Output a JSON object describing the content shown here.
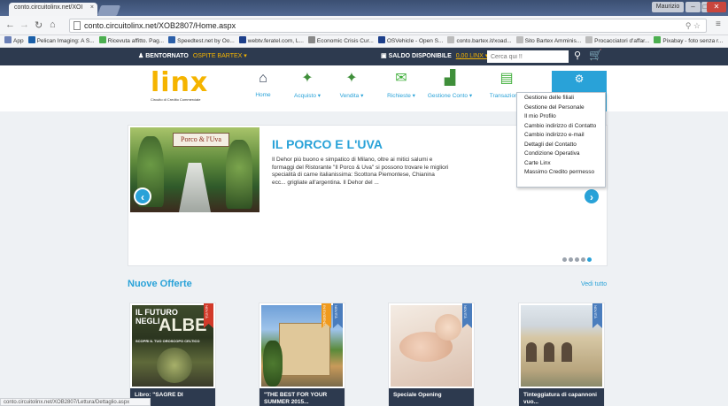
{
  "browser": {
    "tab_title": "conto.circuitolinx.net/XOI",
    "tab_close": "×",
    "user_chip": "Maurizio",
    "win_min": "–",
    "win_max": "□",
    "win_close": "✕",
    "url": "conto.circuitolinx.net/XOB2807/Home.aspx",
    "bookmarks": [
      {
        "label": "App",
        "color": "#6a7fb6"
      },
      {
        "label": "Pelican Imaging: A S...",
        "color": "#1a5fa8"
      },
      {
        "label": "Ricevuta affitto. Pag...",
        "color": "#4caf50"
      },
      {
        "label": "Speedtest.net by Oo...",
        "color": "#2b5fa8"
      },
      {
        "label": "webtv.feratel.com, L...",
        "color": "#1d3f8a"
      },
      {
        "label": "Economic Crisis Cur...",
        "color": "#888888"
      },
      {
        "label": "OSVehicle - Open S...",
        "color": "#1d3f8a"
      },
      {
        "label": "conto.bartex.it/xoad...",
        "color": "#bbbbbb"
      },
      {
        "label": "Sito Bartex Amminis...",
        "color": "#bbbbbb"
      },
      {
        "label": "Procacciatori d'affar...",
        "color": "#bbbbbb"
      },
      {
        "label": "Pixabay - foto senza r...",
        "color": "#4caf50"
      }
    ],
    "status_text": "conto.circuitolinx.net/XOB2807/Lettura/Dettaglio.aspx"
  },
  "topbar": {
    "greeting": "BENTORNATO",
    "guest": "OSPITE BARTEX ▾",
    "saldo_label": "SALDO DISPONIBILE",
    "saldo_amount": "0,00 LINX ▾",
    "search_placeholder": "Cerca qui !!"
  },
  "logo": {
    "text": "linx",
    "sub": "Circuito di Credito Commerciale"
  },
  "menu": [
    {
      "label": "Home",
      "icon": "home-icon",
      "glyph": "⌂",
      "color": "#2d3a4f"
    },
    {
      "label": "Acquisto ▾",
      "icon": "buy-icon",
      "glyph": "✦",
      "color": "#3f8f3a"
    },
    {
      "label": "Vendita ▾",
      "icon": "sell-icon",
      "glyph": "✦",
      "color": "#3f8f3a"
    },
    {
      "label": "Richieste ▾",
      "icon": "requests-icon",
      "glyph": "✉",
      "color": "#3fae3a"
    },
    {
      "label": "Gestione Conto ▾",
      "icon": "chart-icon",
      "glyph": "▟",
      "color": "#3f8f3a"
    },
    {
      "label": "Transazioni ▾",
      "icon": "transactions-icon",
      "glyph": "▤",
      "color": "#3fae3a"
    }
  ],
  "account_menu": {
    "icon": "⚙",
    "items": [
      "Gestione delle filiali",
      "Gestione del Personale",
      "Il mio Profilo",
      "Cambio indirizzo di Contatto",
      "Cambio indirizzo e-mail",
      "Dettagli del Contatto",
      "Condizione Operativa",
      "Carte Linx",
      "Massimo Credito permesso"
    ]
  },
  "hero": {
    "sign": "Porco & l'Uva",
    "title": "IL PORCO E L'UVA",
    "text": "Il Dehor più buono e simpatico di Milano, oltre ai mitici salumi e formaggi del Ristorante \"Il Porco & Uva\" si possono trovare le migliori specialità di carne italianissima: Scottona Piemontese, Chianina ecc... grigliate all'argentina. Il Dehor del ...",
    "prev": "‹",
    "next": "›",
    "slides": 5,
    "active_slide": 4
  },
  "offers": {
    "title": "Nuove Offerte",
    "see_all": "Vedi tutto",
    "cards": [
      {
        "caption": "Libro: \"SAGRE DI",
        "ribbon": "NOVITÀ",
        "cover_line1": "IL FUTURO",
        "cover_line2": "NEGLI",
        "cover_big": "ALBE",
        "cover_sub": "SCOPRI IL TUO OROSCOPO CELTICO"
      },
      {
        "caption": "\"THE BEST FOR YOUR SUMMER 2015...",
        "ribbon": "NOVITÀ",
        "ribbon2": "IN EVIDENZA"
      },
      {
        "caption": "Speciale Opening",
        "ribbon": "NOVITÀ"
      },
      {
        "caption": "Tinteggiatura di capannoni vuo...",
        "ribbon": "NOVITÀ"
      }
    ]
  }
}
